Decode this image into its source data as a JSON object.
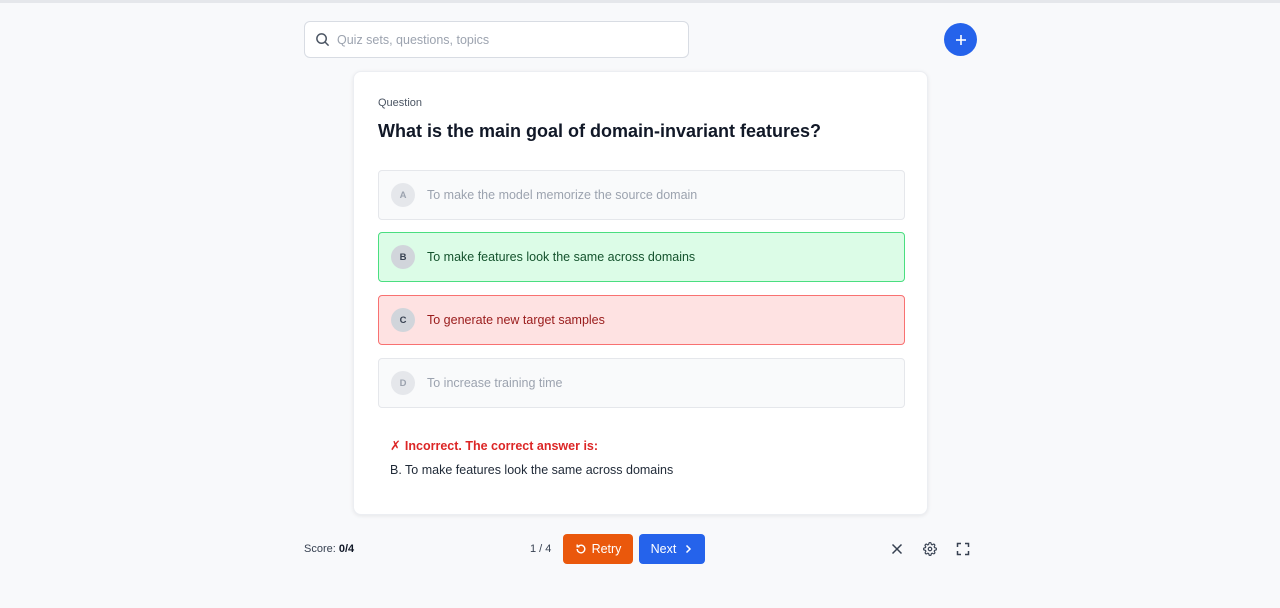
{
  "search": {
    "placeholder": "Quiz sets, questions, topics",
    "icon": "search-icon"
  },
  "add_button": {
    "icon": "plus-icon",
    "color": "#2563eb"
  },
  "question": {
    "label": "Question",
    "text": "What is the main goal of domain-invariant features?"
  },
  "options": [
    {
      "letter": "A",
      "text": "To make the model memorize the source domain",
      "state": "neutral"
    },
    {
      "letter": "B",
      "text": "To make features look the same across domains",
      "state": "correct"
    },
    {
      "letter": "C",
      "text": "To generate new target samples",
      "state": "incorrect"
    },
    {
      "letter": "D",
      "text": "To increase training time",
      "state": "neutral"
    }
  ],
  "feedback": {
    "mark": "✗",
    "title": "Incorrect. The correct answer is:",
    "answer": "B. To make features look the same across domains"
  },
  "footer": {
    "score_label": "Score: ",
    "score_value": "0/4",
    "counter": "1 / 4",
    "retry_label": "Retry",
    "next_label": "Next",
    "retry_color": "#ea580c",
    "next_color": "#2563eb"
  },
  "colors": {
    "correct_bg": "#dcfce7",
    "correct_border": "#4ade80",
    "incorrect_bg": "#fee2e2",
    "incorrect_border": "#f87171",
    "error_text": "#dc2626"
  }
}
